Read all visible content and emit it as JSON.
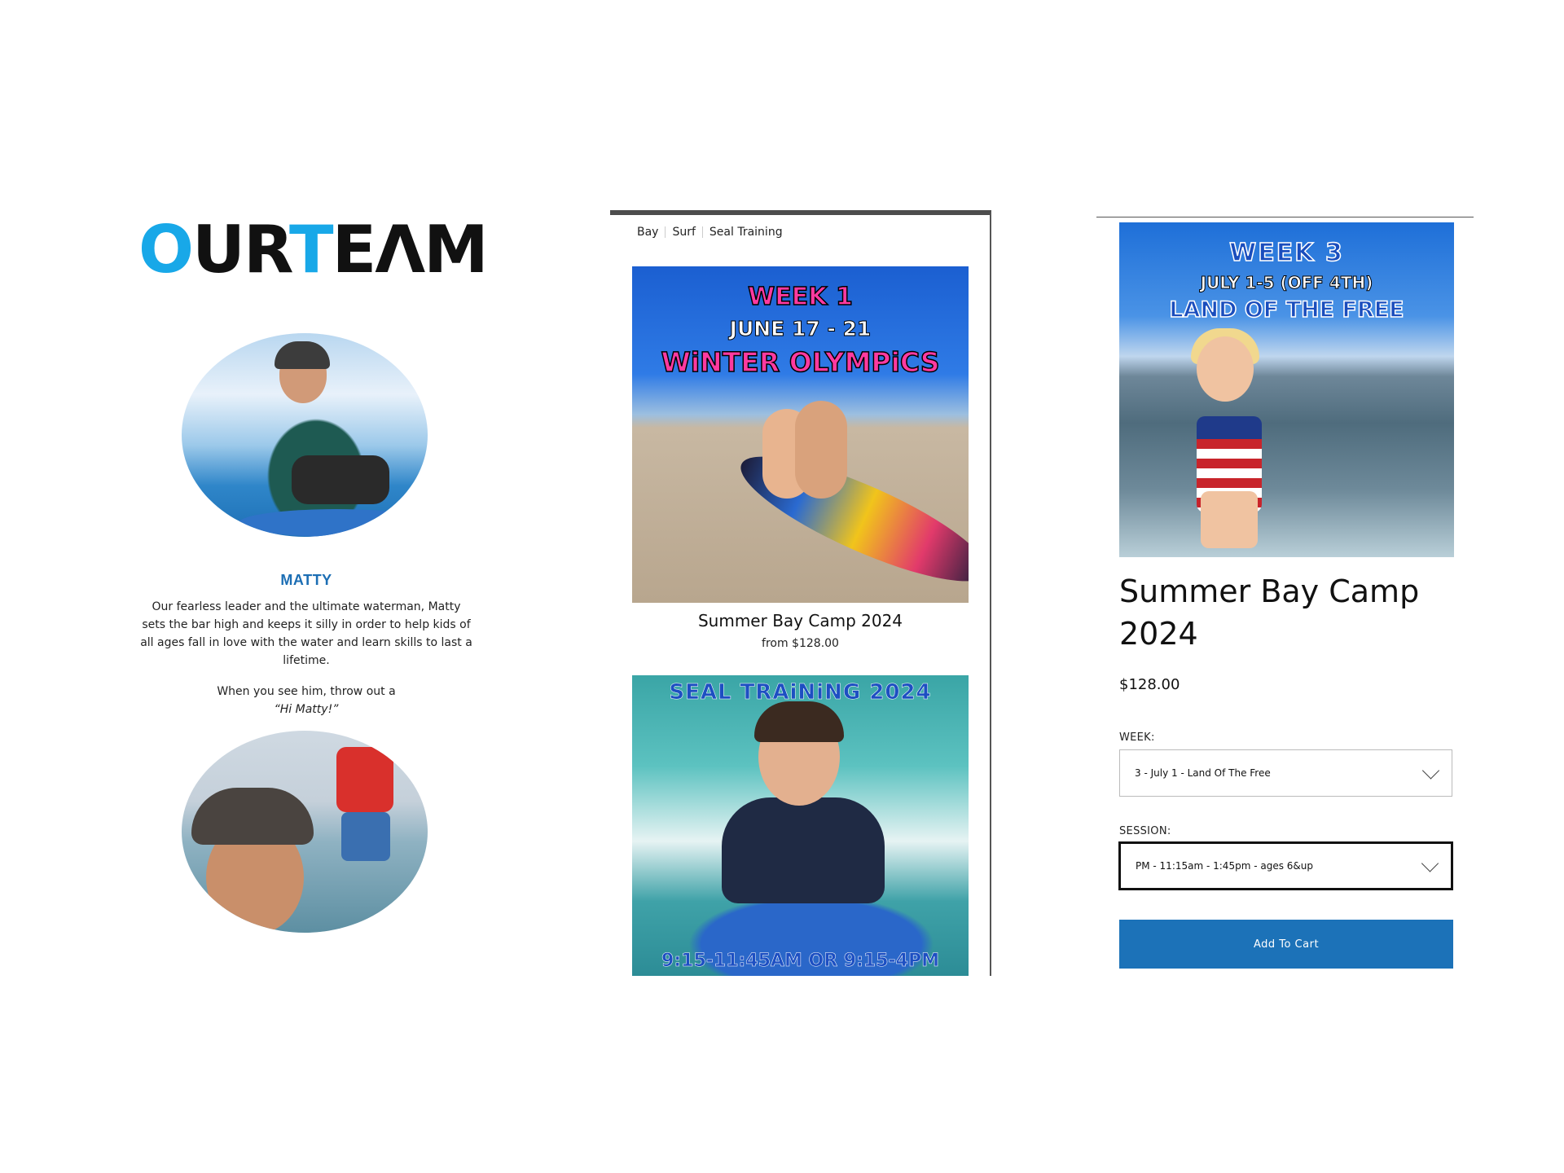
{
  "team": {
    "title_part1": "O",
    "title_part2": "UR",
    "title_part3": "T",
    "title_part4": "EΛM",
    "member_name": "MATTY",
    "member_bio": "Our fearless leader and the ultimate waterman, Matty sets the bar high and keeps it silly in order to help kids of all ages fall in love with the water and learn skills to last a lifetime.",
    "greeting_intro": "When you see him, throw out a",
    "greeting_quote": "“Hi Matty!”"
  },
  "shop": {
    "categories": [
      "Bay",
      "Surf",
      "Seal Training"
    ],
    "products": [
      {
        "image_lines": [
          "WEEK 1",
          "JUNE 17 - 21",
          "WiNTER OLYMPiCS"
        ],
        "name": "Summer Bay Camp 2024",
        "price": "from $128.00"
      },
      {
        "image_lines": [
          "SEAL TRAiNiNG 2024",
          "9:15-11:45AM OR 9:15-4PM"
        ]
      }
    ]
  },
  "product_detail": {
    "image_lines": [
      "WEEK 3",
      "JULY 1-5 (OFF 4TH)",
      "LAND OF THE FREE"
    ],
    "title": "Summer Bay Camp 2024",
    "price": "$128.00",
    "week_label": "WEEK:",
    "week_value": "3 - July 1 - Land Of The Free",
    "session_label": "SESSION:",
    "session_value": "PM - 11:15am - 1:45pm - ages 6&up",
    "add_to_cart_label": "Add To Cart"
  },
  "colors": {
    "brand_blue": "#1c72b8",
    "title_accent": "#18a8e8",
    "pink": "#ff3aa0"
  },
  "icons": {
    "dropdown": "chevron-down-icon"
  }
}
